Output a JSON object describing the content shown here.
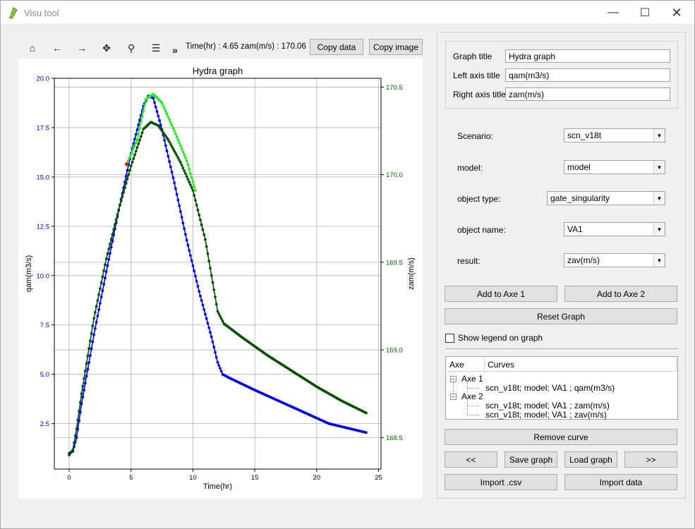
{
  "window": {
    "title": "Visu tool",
    "minimize": "—",
    "maximize": "☐",
    "close": "✕"
  },
  "toolbar": {
    "icons": [
      "home-icon",
      "back-icon",
      "forward-icon",
      "pan-icon",
      "zoom-icon",
      "configure-icon",
      "more-icon"
    ],
    "glyphs": [
      "⌂",
      "←",
      "→",
      "✥",
      "⚲",
      "☰",
      "»"
    ],
    "coord_readout": "Time(hr) : 4.65  zam(m/s) : 170.06",
    "copy_data_label": "Copy data",
    "copy_image_label": "Copy image"
  },
  "chart_data": {
    "type": "line",
    "title": "Hydra graph",
    "xlabel": "Time(hr)",
    "ylabel_left": "qam(m3/s)",
    "ylabel_right": "zam(m/s)",
    "xlim": [
      -1.2,
      25.2
    ],
    "ylim_left": [
      0.2,
      20.0
    ],
    "ylim_right": [
      168.32,
      170.55
    ],
    "xticks": [
      0,
      5,
      10,
      15,
      20,
      25
    ],
    "yticks_left": [
      2.5,
      5.0,
      7.5,
      10.0,
      12.5,
      15.0,
      17.5,
      20.0
    ],
    "yticks_right": [
      168.5,
      169.0,
      169.5,
      170.0,
      170.5
    ],
    "grid": true,
    "left_tick_color": "#0000cc",
    "right_tick_color": "#006400",
    "series": [
      {
        "axis": "left",
        "color": "#0000ee",
        "points": [
          [
            0,
            1.0
          ],
          [
            0.3,
            1.1
          ],
          [
            0.6,
            1.8
          ],
          [
            1,
            3.5
          ],
          [
            2,
            7.0
          ],
          [
            3,
            10.2
          ],
          [
            4,
            13.3
          ],
          [
            5,
            16.2
          ],
          [
            6,
            18.6
          ],
          [
            6.4,
            19.1
          ],
          [
            6.8,
            19.0
          ],
          [
            7.5,
            17.4
          ],
          [
            8.5,
            14.7
          ],
          [
            9.5,
            11.8
          ],
          [
            10.5,
            9.2
          ],
          [
            11.5,
            6.9
          ],
          [
            12.0,
            5.6
          ],
          [
            12.4,
            5.0
          ],
          [
            13,
            4.8
          ],
          [
            15,
            4.2
          ],
          [
            18,
            3.35
          ],
          [
            21,
            2.5
          ],
          [
            24,
            2.05
          ]
        ]
      },
      {
        "axis": "right",
        "color": "#005000",
        "points": [
          [
            0,
            168.4
          ],
          [
            0.3,
            168.43
          ],
          [
            0.6,
            168.55
          ],
          [
            1,
            168.75
          ],
          [
            2,
            169.18
          ],
          [
            3,
            169.52
          ],
          [
            4,
            169.8
          ],
          [
            5,
            170.05
          ],
          [
            6,
            170.26
          ],
          [
            6.6,
            170.3
          ],
          [
            7.2,
            170.28
          ],
          [
            8,
            170.2
          ],
          [
            9,
            170.07
          ],
          [
            10,
            169.91
          ],
          [
            11,
            169.63
          ],
          [
            12,
            169.22
          ],
          [
            12.5,
            169.15
          ],
          [
            14,
            169.07
          ],
          [
            16,
            168.97
          ],
          [
            18,
            168.88
          ],
          [
            20,
            168.79
          ],
          [
            22,
            168.71
          ],
          [
            24,
            168.64
          ]
        ]
      },
      {
        "axis": "right",
        "color": "#22ee22",
        "points": [
          [
            4.65,
            170.06
          ],
          [
            5.5,
            170.2
          ],
          [
            6.2,
            170.43
          ],
          [
            6.8,
            170.46
          ],
          [
            7.5,
            170.41
          ],
          [
            8.5,
            170.25
          ],
          [
            9.5,
            170.08
          ],
          [
            10.2,
            169.91
          ]
        ]
      }
    ],
    "marker": {
      "x": 4.65,
      "y_right": 170.06,
      "color": "#ff0000"
    }
  },
  "settings": {
    "graph_title_label": "Graph title",
    "graph_title_value": "Hydra graph",
    "left_axis_label": "Left axis title",
    "left_axis_value": "qam(m3/s)",
    "right_axis_label": "Right axis title",
    "right_axis_value": "zam(m/s)"
  },
  "selectors": {
    "scenario_label": "Scenario:",
    "scenario_value": "scn_v18t",
    "model_label": "model:",
    "model_value": "model",
    "object_type_label": "object type:",
    "object_type_value": "gate_singularity",
    "object_name_label": "object name:",
    "object_name_value": "VA1",
    "result_label": "result:",
    "result_value": "zav(m/s)"
  },
  "actions": {
    "add_axe1": "Add to Axe 1",
    "add_axe2": "Add to Axe 2",
    "reset_graph": "Reset Graph",
    "show_legend": "Show legend on graph",
    "remove_curve": "Remove curve",
    "prev": "<<",
    "save_graph": "Save graph",
    "load_graph": "Load graph",
    "next": ">>",
    "import_csv": "Import .csv",
    "import_data": "Import data"
  },
  "tree": {
    "col_axe": "Axe",
    "col_curves": "Curves",
    "axe1_label": "Axe 1",
    "axe1_curve1": "scn_v18t; model; VA1 ; qam(m3/s)",
    "axe2_label": "Axe 2",
    "axe2_curve1": "scn_v18t; model; VA1 ; zam(m/s)",
    "axe2_curve2": "scn_v18t; model; VA1 ; zav(m/s)"
  }
}
